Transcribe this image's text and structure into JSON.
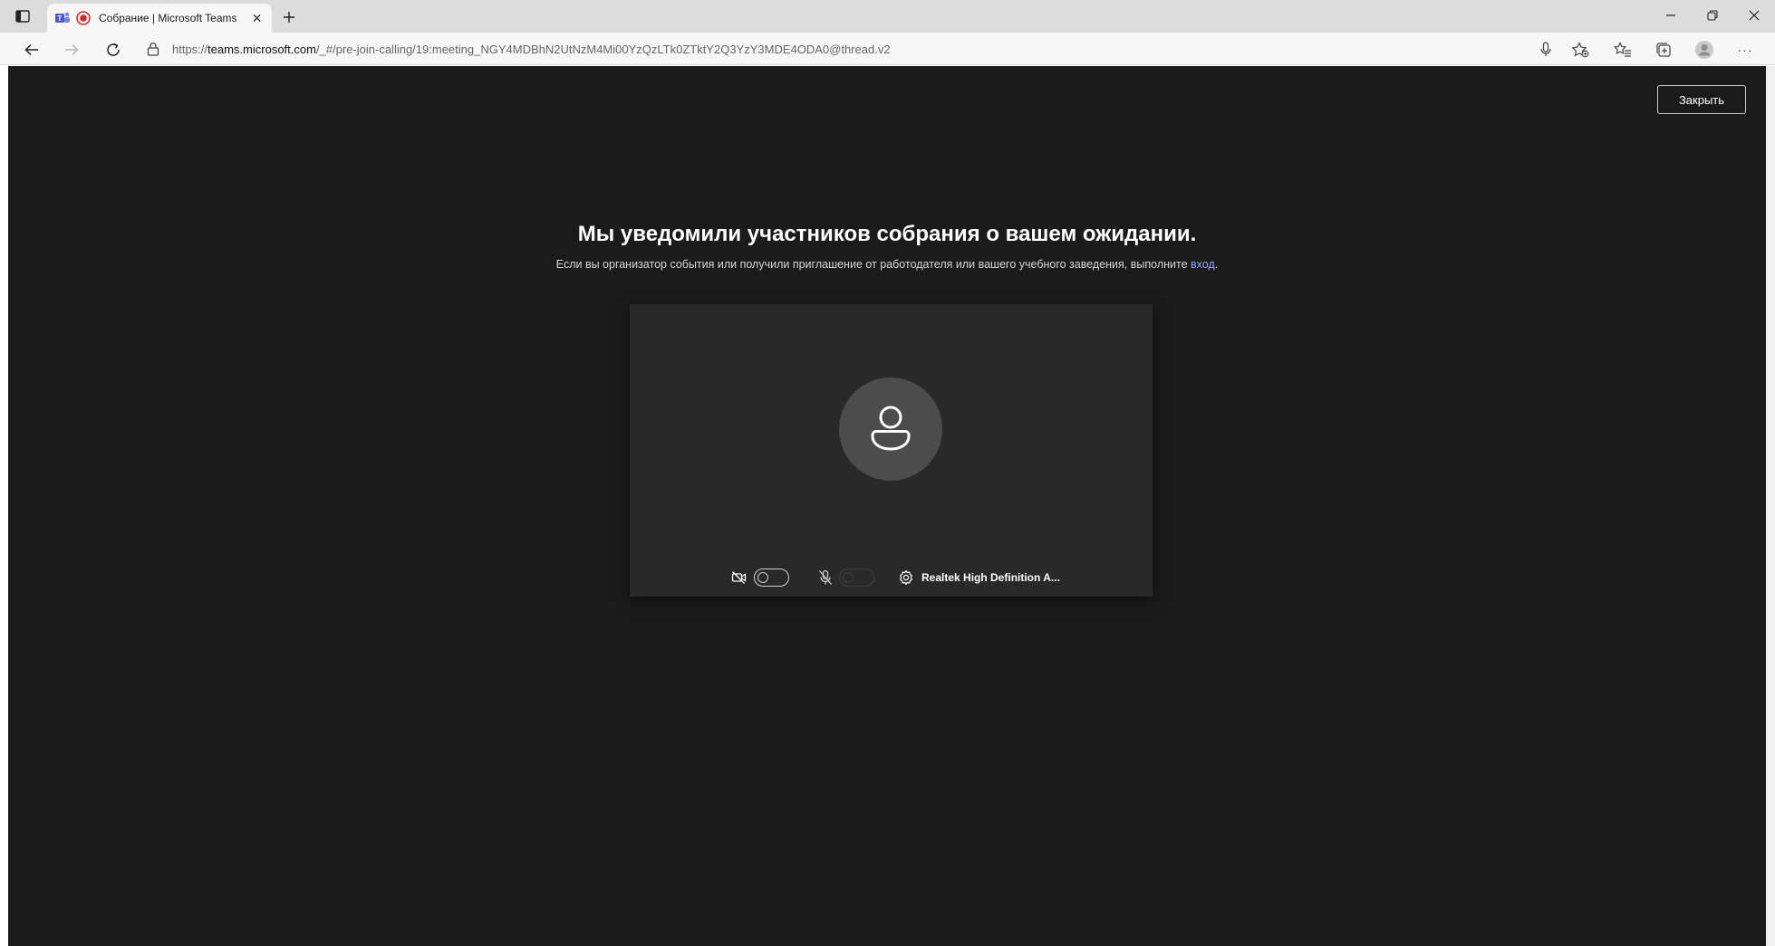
{
  "browser": {
    "tab": {
      "title": "Собрание | Microsoft Teams",
      "close_glyph": "✕"
    },
    "new_tab_glyph": "+",
    "url": {
      "prefix": "https://",
      "host": "teams.microsoft.com",
      "rest": "/_#/pre-join-calling/19:meeting_NGY4MDBhN2UtNzM4Mi00YzQzLTk0ZTktY2Q3YzY3MDE4ODA0@thread.v2"
    },
    "more_glyph": "···"
  },
  "page": {
    "close_button_label": "Закрыть",
    "headline": "Мы уведомили участников собрания о вашем ожидании.",
    "subline_text": "Если вы организатор события или получили приглашение от работодателя или вашего учебного заведения, выполните ",
    "subline_link": "вход",
    "subline_end": "."
  },
  "preview": {
    "camera_toggle": false,
    "mic_toggle": false,
    "audio_device": "Realtek High Definition A..."
  },
  "colors": {
    "content_bg": "#1b1b1b",
    "preview_bg": "#292929",
    "avatar_bg": "#4c4c4c",
    "link": "#9ea2ff",
    "recording_red": "#d62b2b",
    "teams_purple": "#5059c9"
  },
  "icons": [
    "tab-actions-icon",
    "teams-icon",
    "recording-icon",
    "close-icon",
    "plus-icon",
    "minimize-icon",
    "restore-icon",
    "window-close-icon",
    "back-arrow-icon",
    "forward-arrow-icon",
    "refresh-icon",
    "lock-icon",
    "read-aloud-icon",
    "add-favorite-icon",
    "favorites-icon",
    "collections-icon",
    "profile-icon",
    "more-icon",
    "person-icon",
    "camera-off-icon",
    "mic-off-icon",
    "settings-icon"
  ]
}
